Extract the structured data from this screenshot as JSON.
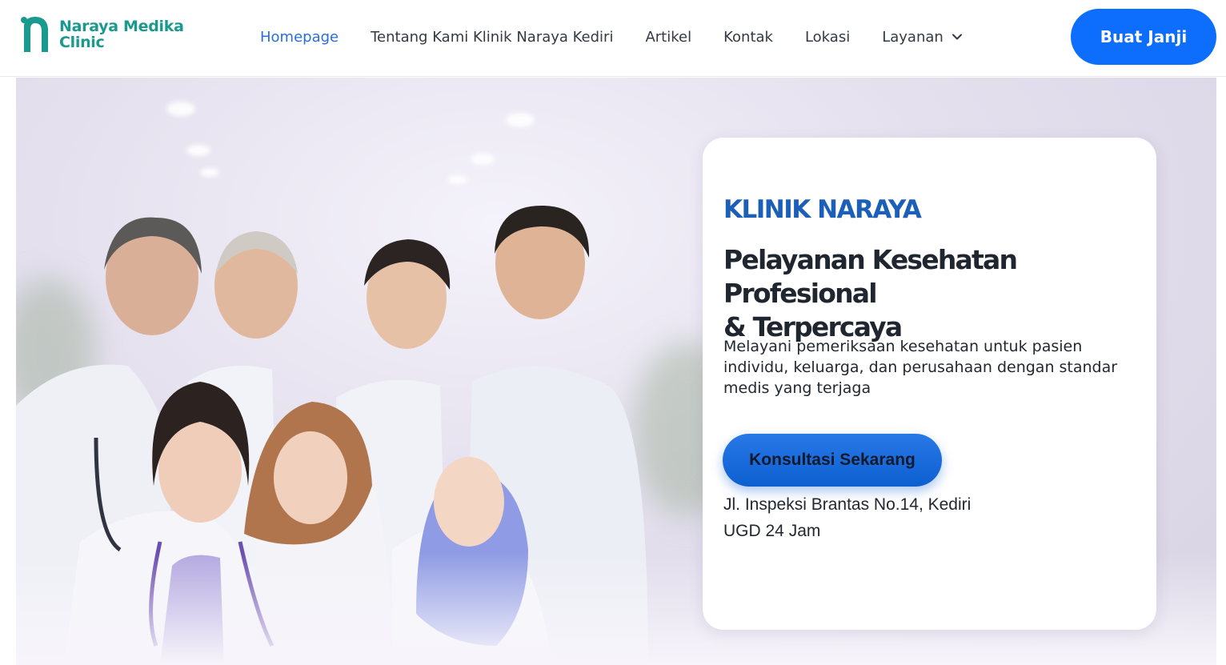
{
  "brand": {
    "name_line1": "Naraya Medika",
    "name_line2": "Clinic",
    "color": "#1a9a8f"
  },
  "nav": {
    "items": [
      {
        "label": "Homepage",
        "active": true
      },
      {
        "label": "Tentang Kami Klinik Naraya Kediri",
        "active": false
      },
      {
        "label": "Artikel",
        "active": false
      },
      {
        "label": "Kontak",
        "active": false
      },
      {
        "label": "Lokasi",
        "active": false
      }
    ],
    "dropdown": {
      "label": "Layanan",
      "icon": "chevron-down-icon"
    }
  },
  "header_cta": {
    "label": "Buat Janji",
    "color": "#0d6efd"
  },
  "hero": {
    "eyebrow": "KLINIK NARAYA",
    "headline_line1": "Pelayanan Kesehatan Profesional",
    "headline_line2": "& Terpercaya",
    "description": "Melayani pemeriksaan kesehatan untuk pasien individu, keluarga, dan perusahaan dengan standar medis yang terjaga",
    "button_label": "Konsultasi Sekarang",
    "address": "Jl. Inspeksi Brantas No.14, Kediri",
    "hours": "UGD 24 Jam",
    "image": "team-of-medical-staff-photo"
  },
  "colors": {
    "accent": "#2a6fd6",
    "eyebrow": "#1c5fb8",
    "heading": "#1f2630"
  }
}
